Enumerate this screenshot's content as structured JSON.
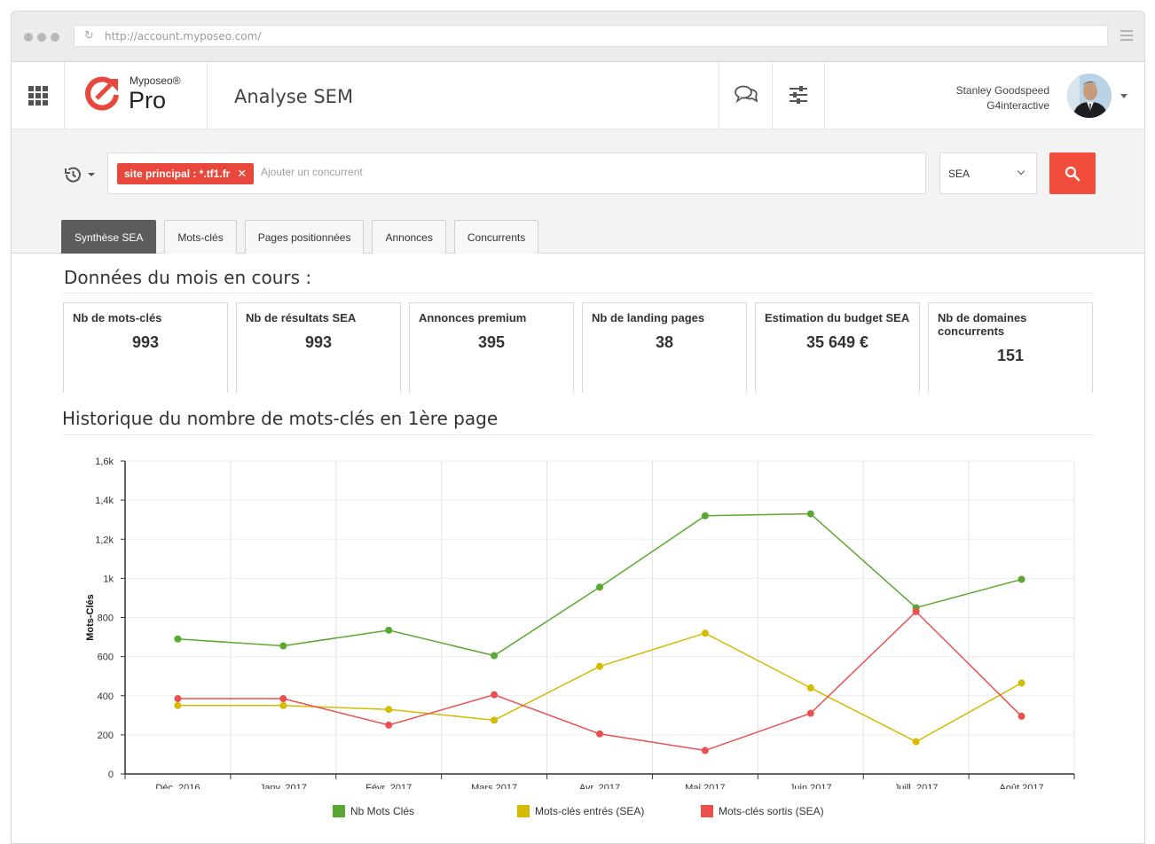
{
  "browser": {
    "url": "http://account.myposeo.com/"
  },
  "header": {
    "brand": "Myposeo®",
    "product": "Pro",
    "page_title": "Analyse SEM",
    "user_name": "Stanley Goodspeed",
    "user_company": "G4interactive"
  },
  "search": {
    "chip_label": "site principal : *.tf1.fr",
    "chip_close": "✕",
    "placeholder": "Ajouter un concurrent",
    "select_value": "SEA"
  },
  "tabs": [
    "Synthèse SEA",
    "Mots-clés",
    "Pages positionnées",
    "Annonces",
    "Concurrents"
  ],
  "stats": {
    "title": "Données du mois en cours :",
    "cards": [
      {
        "label": "Nb de mots-clés",
        "value": "993"
      },
      {
        "label": "Nb de résultats SEA",
        "value": "993"
      },
      {
        "label": "Annonces premium",
        "value": "395"
      },
      {
        "label": "Nb de landing pages",
        "value": "38"
      },
      {
        "label": "Estimation du budget SEA",
        "value": "35 649 €"
      },
      {
        "label": "Nb de domaines concurrents",
        "value": "151"
      }
    ]
  },
  "history": {
    "title": "Historique du nombre de mots-clés en 1ère page"
  },
  "colors": {
    "accent": "#f24c3d",
    "green": "#5aa832",
    "yellow": "#d4bb00",
    "red": "#ea5050"
  },
  "chart_data": {
    "type": "line",
    "categories": [
      "Déc. 2016",
      "Janv. 2017",
      "Févr. 2017",
      "Mars 2017",
      "Avr. 2017",
      "Mai 2017",
      "Juin 2017",
      "Juill. 2017",
      "Août 2017"
    ],
    "ylabel": "Mots-Clés",
    "ylim": [
      0,
      1600
    ],
    "yticks": [
      0,
      200,
      400,
      600,
      800,
      1000,
      1200,
      1400,
      1600
    ],
    "ytick_labels": [
      "0",
      "200",
      "400",
      "600",
      "800",
      "1k",
      "1,2k",
      "1,4k",
      "1,6k"
    ],
    "grid": true,
    "legend_position": "bottom",
    "series": [
      {
        "name": "Nb Mots Clés",
        "color": "#5aa832",
        "values": [
          690,
          655,
          735,
          605,
          955,
          1320,
          1330,
          850,
          995
        ]
      },
      {
        "name": "Mots-clés entrés (SEA)",
        "color": "#d4bb00",
        "values": [
          350,
          350,
          330,
          275,
          550,
          720,
          440,
          165,
          465
        ]
      },
      {
        "name": "Mots-clés sortis (SEA)",
        "color": "#ea5050",
        "values": [
          385,
          385,
          250,
          405,
          205,
          120,
          310,
          830,
          295
        ]
      }
    ]
  }
}
